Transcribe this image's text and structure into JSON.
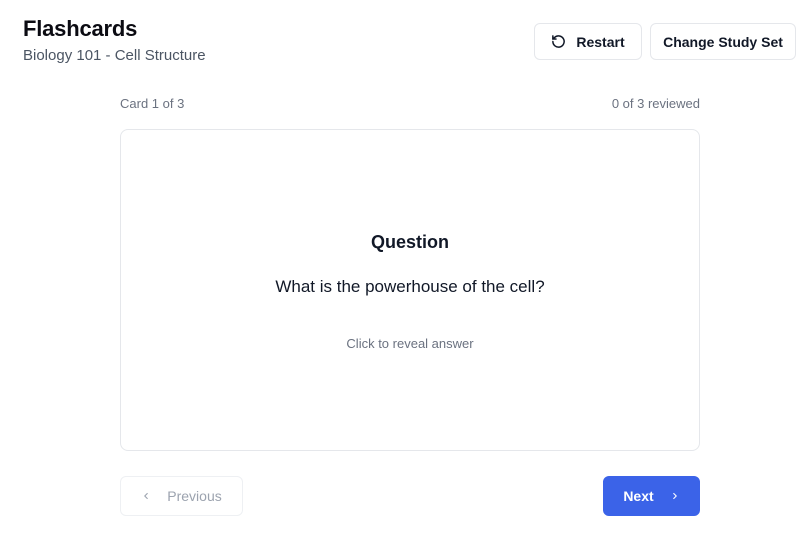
{
  "header": {
    "title": "Flashcards",
    "subtitle": "Biology 101 - Cell Structure"
  },
  "toolbar": {
    "restart_label": "Restart",
    "restart_icon": "rotate-ccw-icon",
    "change_set_label": "Change Study Set"
  },
  "progress": {
    "card_position": "Card 1 of 3",
    "reviewed": "0 of 3 reviewed"
  },
  "card": {
    "heading": "Question",
    "text": "What is the powerhouse of the cell?",
    "hint": "Click to reveal answer"
  },
  "navigation": {
    "previous_label": "Previous",
    "previous_icon": "chevron-left-icon",
    "next_label": "Next",
    "next_icon": "chevron-right-icon"
  },
  "colors": {
    "accent": "#3b63e8",
    "border": "#e5e7eb",
    "muted_text": "#6b7280"
  }
}
